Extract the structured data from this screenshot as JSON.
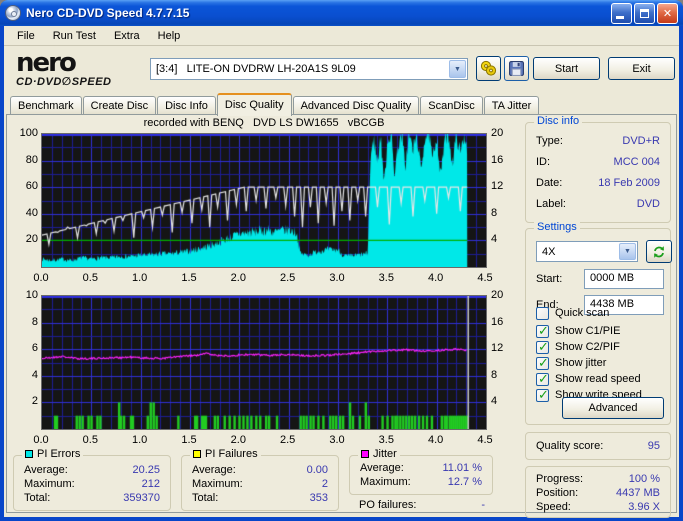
{
  "window": {
    "title": "Nero CD-DVD Speed 4.7.7.15"
  },
  "menu": {
    "items": [
      "File",
      "Run Test",
      "Extra",
      "Help"
    ]
  },
  "toolbar": {
    "logo_line1": "nero",
    "logo_line2": "CD·DVD∅SPEED",
    "drive_selected": "[3:4]   LITE-ON DVDRW LH-20A1S 9L09",
    "start_label": "Start",
    "exit_label": "Exit"
  },
  "tabs": {
    "items": [
      "Benchmark",
      "Create Disc",
      "Disc Info",
      "Disc Quality",
      "Advanced Disc Quality",
      "ScanDisc",
      "TA Jitter"
    ],
    "active": "Disc Quality"
  },
  "chart_header": "recorded with BENQ   DVD LS DW1655   vBCGB",
  "disc_info": {
    "caption": "Disc info",
    "rows": [
      {
        "label": "Type:",
        "value": "DVD+R"
      },
      {
        "label": "ID:",
        "value": "MCC 004"
      },
      {
        "label": "Date:",
        "value": "18 Feb 2009"
      },
      {
        "label": "Label:",
        "value": "DVD"
      }
    ]
  },
  "settings": {
    "caption": "Settings",
    "speed_selected": "4X",
    "start_label": "Start:",
    "start_value": "0000 MB",
    "end_label": "End:",
    "end_value": "4438 MB",
    "checkboxes": [
      {
        "label": "Quick scan",
        "checked": false
      },
      {
        "label": "Show C1/PIE",
        "checked": true
      },
      {
        "label": "Show C2/PIF",
        "checked": true
      },
      {
        "label": "Show jitter",
        "checked": true
      },
      {
        "label": "Show read speed",
        "checked": true
      },
      {
        "label": "Show write speed",
        "checked": true
      }
    ],
    "advanced_label": "Advanced"
  },
  "quality": {
    "label": "Quality score:",
    "value": "95"
  },
  "progress": {
    "rows": [
      {
        "label": "Progress:",
        "value": "100 %"
      },
      {
        "label": "Position:",
        "value": "4437 MB"
      },
      {
        "label": "Speed:",
        "value": "3.96 X"
      }
    ]
  },
  "stats": {
    "pi_errors": {
      "caption": "PI Errors",
      "legend_color": "#00E8E8",
      "rows": [
        {
          "label": "Average:",
          "value": "20.25"
        },
        {
          "label": "Maximum:",
          "value": "212"
        },
        {
          "label": "Total:",
          "value": "359370"
        }
      ]
    },
    "pi_failures": {
      "caption": "PI Failures",
      "legend_color": "#FFFF00",
      "rows": [
        {
          "label": "Average:",
          "value": "0.00"
        },
        {
          "label": "Maximum:",
          "value": "2"
        },
        {
          "label": "Total:",
          "value": "353"
        }
      ]
    },
    "jitter": {
      "caption": "Jitter",
      "legend_color": "#FF00FF",
      "rows": [
        {
          "label": "Average:",
          "value": "11.01 %"
        },
        {
          "label": "Maximum:",
          "value": "12.7 %"
        }
      ]
    },
    "po_failures": {
      "label": "PO failures:",
      "value": "-"
    }
  },
  "colors": {
    "pi_area": "#00E8E8",
    "write_line": "#E6E6E6",
    "read_line": "#00B000",
    "jitter_line": "#FF22FF",
    "pif_bar": "#22CC22",
    "cursor": "#C8C8C8",
    "plot_bg": "#151515",
    "grid_minor": "#1D1D96",
    "grid_major": "#3030D8",
    "value_text": "#3939B0",
    "caption_blue": "#0046D5"
  },
  "chart_data": [
    {
      "type": "area",
      "title": "PI Errors / read-write speed",
      "x_range": [
        0,
        4.5
      ],
      "x_ticks": [
        "0.0",
        "0.5",
        "1.0",
        "1.5",
        "2.0",
        "2.5",
        "3.0",
        "3.5",
        "4.0",
        "4.5"
      ],
      "y_left_ticks": [
        "100",
        "80",
        "60",
        "40",
        "20"
      ],
      "y_right_ticks": [
        "20",
        "16",
        "12",
        "8",
        "4"
      ],
      "y_left_max": 100,
      "data_end_x": 4.31,
      "read_speed_level": 20,
      "write_speed_base": [
        [
          0,
          24
        ],
        [
          2.05,
          60
        ],
        [
          4.31,
          60
        ]
      ],
      "write_speed_dips": [
        [
          0.07,
          17
        ],
        [
          0.16,
          26
        ],
        [
          0.26,
          30
        ],
        [
          0.36,
          22
        ],
        [
          0.45,
          31
        ],
        [
          0.55,
          25
        ],
        [
          0.64,
          33
        ],
        [
          0.73,
          27
        ],
        [
          0.82,
          35
        ],
        [
          0.93,
          22
        ],
        [
          1.03,
          37
        ],
        [
          1.12,
          30
        ],
        [
          1.22,
          39
        ],
        [
          1.32,
          26
        ],
        [
          1.42,
          41
        ],
        [
          1.52,
          33
        ],
        [
          1.62,
          43
        ],
        [
          1.7,
          30
        ],
        [
          1.78,
          45
        ],
        [
          1.88,
          35
        ],
        [
          1.97,
          47
        ],
        [
          2.07,
          42
        ],
        [
          2.17,
          50
        ],
        [
          2.27,
          44
        ],
        [
          2.37,
          52
        ],
        [
          2.47,
          46
        ],
        [
          2.56,
          38
        ],
        [
          2.64,
          30
        ],
        [
          2.72,
          45
        ],
        [
          2.8,
          33
        ],
        [
          2.88,
          48
        ],
        [
          2.96,
          31
        ],
        [
          3.04,
          42
        ],
        [
          3.12,
          35
        ],
        [
          3.2,
          50
        ],
        [
          3.28,
          38
        ],
        [
          3.4,
          45
        ],
        [
          3.52,
          32
        ],
        [
          3.64,
          48
        ],
        [
          3.76,
          38
        ],
        [
          3.88,
          50
        ],
        [
          4.0,
          40
        ],
        [
          4.12,
          52
        ],
        [
          4.24,
          42
        ]
      ],
      "pi_envelope": [
        [
          0,
          6
        ],
        [
          0.1,
          5
        ],
        [
          0.2,
          6
        ],
        [
          0.3,
          5
        ],
        [
          0.4,
          7
        ],
        [
          0.5,
          6
        ],
        [
          0.6,
          7
        ],
        [
          0.7,
          7
        ],
        [
          0.8,
          8
        ],
        [
          0.9,
          8
        ],
        [
          1.0,
          9
        ],
        [
          1.1,
          9
        ],
        [
          1.2,
          10
        ],
        [
          1.3,
          10
        ],
        [
          1.4,
          11
        ],
        [
          1.5,
          12
        ],
        [
          1.6,
          14
        ],
        [
          1.7,
          16
        ],
        [
          1.8,
          19
        ],
        [
          1.9,
          22
        ],
        [
          2.0,
          25
        ],
        [
          2.1,
          26
        ],
        [
          2.2,
          27
        ],
        [
          2.3,
          28
        ],
        [
          2.35,
          26
        ],
        [
          2.4,
          27
        ],
        [
          2.5,
          28
        ],
        [
          2.58,
          26
        ],
        [
          2.62,
          10
        ],
        [
          2.7,
          9
        ],
        [
          2.8,
          12
        ],
        [
          2.9,
          13
        ],
        [
          3.0,
          13
        ],
        [
          3.05,
          9
        ],
        [
          3.1,
          8
        ],
        [
          3.2,
          9
        ],
        [
          3.3,
          10
        ],
        [
          3.33,
          80
        ],
        [
          3.36,
          98
        ],
        [
          3.4,
          78
        ],
        [
          3.43,
          100
        ],
        [
          3.47,
          62
        ],
        [
          3.5,
          95
        ],
        [
          3.54,
          100
        ],
        [
          3.57,
          70
        ],
        [
          3.61,
          92
        ],
        [
          3.65,
          100
        ],
        [
          3.68,
          75
        ],
        [
          3.72,
          100
        ],
        [
          3.76,
          88
        ],
        [
          3.8,
          100
        ],
        [
          3.84,
          72
        ],
        [
          3.88,
          98
        ],
        [
          3.92,
          100
        ],
        [
          3.96,
          80
        ],
        [
          4.0,
          100
        ],
        [
          4.04,
          68
        ],
        [
          4.08,
          96
        ],
        [
          4.12,
          100
        ],
        [
          4.16,
          78
        ],
        [
          4.2,
          100
        ],
        [
          4.24,
          85
        ],
        [
          4.28,
          100
        ],
        [
          4.31,
          90
        ]
      ]
    },
    {
      "type": "bars+line",
      "title": "PI Failures / Jitter",
      "x_ticks": [
        "0.0",
        "0.5",
        "1.0",
        "1.5",
        "2.0",
        "2.5",
        "3.0",
        "3.5",
        "4.0",
        "4.5"
      ],
      "y_left_ticks": [
        "10",
        "8",
        "6",
        "4",
        "2"
      ],
      "y_right_ticks": [
        "20",
        "16",
        "12",
        "8",
        "4"
      ],
      "y_left_max": 10,
      "data_end_x": 4.31,
      "cursor_x": 4.32,
      "jitter_points": [
        [
          0,
          5.3
        ],
        [
          0.2,
          5.45
        ],
        [
          0.35,
          5.3
        ],
        [
          0.5,
          5.3
        ],
        [
          0.7,
          5.35
        ],
        [
          0.9,
          5.4
        ],
        [
          1.0,
          5.35
        ],
        [
          1.2,
          5.3
        ],
        [
          1.4,
          5.45
        ],
        [
          1.6,
          5.55
        ],
        [
          1.65,
          5.7
        ],
        [
          1.8,
          5.5
        ],
        [
          2.0,
          5.55
        ],
        [
          2.1,
          5.6
        ],
        [
          2.3,
          5.55
        ],
        [
          2.5,
          5.6
        ],
        [
          2.7,
          5.5
        ],
        [
          2.9,
          5.55
        ],
        [
          3.0,
          5.6
        ],
        [
          3.1,
          5.65
        ],
        [
          3.3,
          5.8
        ],
        [
          3.5,
          5.9
        ],
        [
          3.7,
          5.95
        ],
        [
          3.9,
          5.85
        ],
        [
          4.1,
          5.95
        ],
        [
          4.25,
          6.0
        ],
        [
          4.31,
          5.9
        ]
      ],
      "pif_bars": [
        [
          0.13,
          1
        ],
        [
          0.15,
          1
        ],
        [
          0.35,
          1
        ],
        [
          0.38,
          1
        ],
        [
          0.41,
          1
        ],
        [
          0.47,
          1
        ],
        [
          0.5,
          1
        ],
        [
          0.56,
          1
        ],
        [
          0.59,
          1
        ],
        [
          0.78,
          2
        ],
        [
          0.8,
          1
        ],
        [
          0.83,
          1
        ],
        [
          0.9,
          1
        ],
        [
          0.92,
          1
        ],
        [
          1.07,
          1
        ],
        [
          1.1,
          2
        ],
        [
          1.13,
          2
        ],
        [
          1.16,
          1
        ],
        [
          1.38,
          1
        ],
        [
          1.55,
          1
        ],
        [
          1.57,
          1
        ],
        [
          1.62,
          1
        ],
        [
          1.64,
          1
        ],
        [
          1.66,
          1
        ],
        [
          1.75,
          1
        ],
        [
          1.78,
          1
        ],
        [
          1.85,
          1
        ],
        [
          1.9,
          1
        ],
        [
          1.95,
          1
        ],
        [
          2.0,
          1
        ],
        [
          2.04,
          1
        ],
        [
          2.08,
          1
        ],
        [
          2.12,
          1
        ],
        [
          2.17,
          1
        ],
        [
          2.21,
          1
        ],
        [
          2.27,
          1
        ],
        [
          2.3,
          1
        ],
        [
          2.38,
          1
        ],
        [
          2.62,
          1
        ],
        [
          2.65,
          1
        ],
        [
          2.68,
          1
        ],
        [
          2.72,
          1
        ],
        [
          2.75,
          1
        ],
        [
          2.8,
          1
        ],
        [
          2.85,
          1
        ],
        [
          2.92,
          1
        ],
        [
          2.95,
          1
        ],
        [
          2.98,
          1
        ],
        [
          3.02,
          1
        ],
        [
          3.05,
          1
        ],
        [
          3.12,
          2
        ],
        [
          3.15,
          1
        ],
        [
          3.22,
          1
        ],
        [
          3.28,
          2
        ],
        [
          3.31,
          1
        ],
        [
          3.45,
          1
        ],
        [
          3.5,
          1
        ],
        [
          3.55,
          1
        ],
        [
          3.58,
          1
        ],
        [
          3.6,
          1
        ],
        [
          3.63,
          1
        ],
        [
          3.66,
          1
        ],
        [
          3.69,
          1
        ],
        [
          3.72,
          1
        ],
        [
          3.75,
          1
        ],
        [
          3.78,
          1
        ],
        [
          3.82,
          1
        ],
        [
          3.86,
          1
        ],
        [
          3.9,
          1
        ],
        [
          3.95,
          1
        ],
        [
          4.05,
          1
        ],
        [
          4.08,
          1
        ],
        [
          4.1,
          1
        ],
        [
          4.13,
          1
        ],
        [
          4.15,
          1
        ],
        [
          4.17,
          1
        ],
        [
          4.19,
          1
        ],
        [
          4.21,
          1
        ],
        [
          4.23,
          1
        ],
        [
          4.25,
          1
        ],
        [
          4.27,
          1
        ],
        [
          4.29,
          1
        ],
        [
          4.31,
          1
        ]
      ]
    }
  ]
}
